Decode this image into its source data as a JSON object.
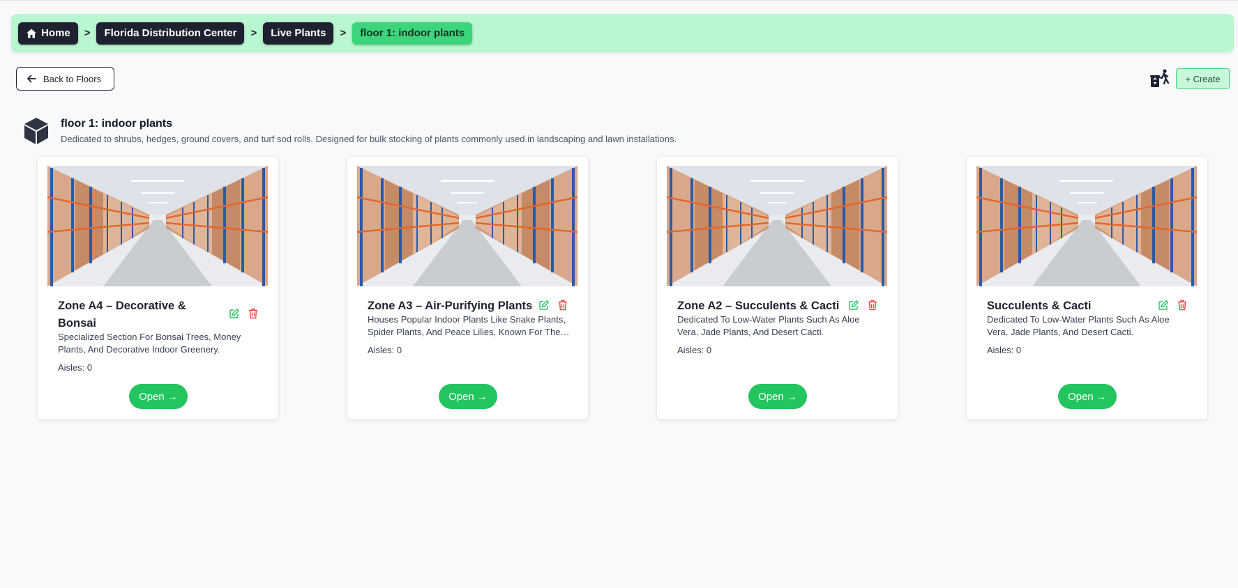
{
  "breadcrumb": {
    "items": [
      {
        "label": "Home"
      },
      {
        "label": "Florida Distribution Center"
      },
      {
        "label": "Live Plants"
      },
      {
        "label": "floor 1: indoor plants"
      }
    ],
    "separator": ">"
  },
  "toolbar": {
    "back_label": "Back to Floors",
    "create_label": "+ Create"
  },
  "floor": {
    "title": "floor 1: indoor plants",
    "description": "Dedicated to shrubs, hedges, ground covers, and turf sod rolls. Designed for bulk stocking of plants commonly used in landscaping and lawn installations."
  },
  "zones": [
    {
      "title": "Zone A4 – Decorative & Bonsai",
      "description": "Specialized Section For Bonsai Trees, Money Plants, And Decorative Indoor Greenery.",
      "aisles": "Aisles: 0",
      "open_label": "Open →"
    },
    {
      "title": "Zone A3 – Air-Purifying Plants",
      "description": "Houses Popular Indoor Plants Like Snake Plants, Spider Plants, And Peace Lilies, Known For Their Air-Purifying Qualities.",
      "aisles": "Aisles: 0",
      "open_label": "Open →"
    },
    {
      "title": "Zone A2 – Succulents & Cacti",
      "description": "Dedicated To Low-Water Plants Such As Aloe Vera, Jade Plants, And Desert Cacti.",
      "aisles": "Aisles: 0",
      "open_label": "Open →"
    },
    {
      "title": "Succulents & Cacti",
      "description": "Dedicated To Low-Water Plants Such As Aloe Vera, Jade Plants, And Desert Cacti.",
      "aisles": "Aisles: 0",
      "open_label": "Open →"
    }
  ],
  "colors": {
    "breadcrumb_bar": "#b8f7d0",
    "crumb_dark": "#1e2230",
    "crumb_active": "#3dd57c",
    "open_button": "#22c55e",
    "edit_icon": "#22c55e",
    "trash_icon": "#ef4444"
  },
  "icons": {
    "home": "home-icon",
    "back": "arrow-left-icon",
    "recycle": "recycle-person-icon",
    "floor": "cube-icon",
    "edit": "edit-icon",
    "delete": "trash-icon"
  }
}
